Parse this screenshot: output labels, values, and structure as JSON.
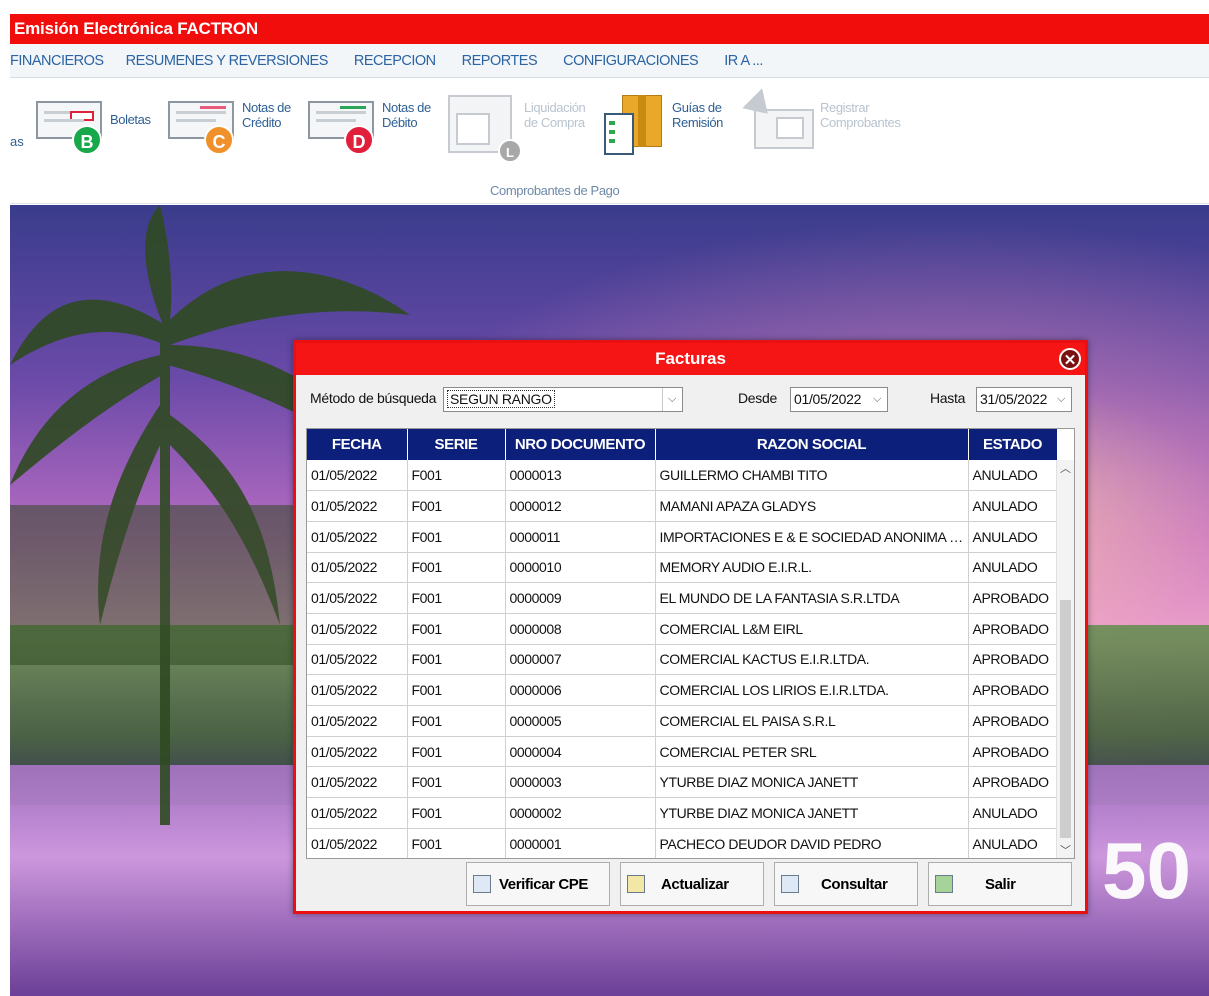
{
  "window": {
    "title": "Emisión Electrónica FACTRON"
  },
  "menu": [
    "FINANCIEROS",
    "RESUMENES Y REVERSIONES",
    "RECEPCION",
    "REPORTES",
    "CONFIGURACIONES",
    "IR A ..."
  ],
  "ribbon": {
    "partial_label": "as",
    "group_label": "Comprobantes de Pago",
    "buttons": {
      "boletas": {
        "label": "Boletas",
        "badge": "B",
        "badge_color": "#17a84b"
      },
      "notas_credito": {
        "line1": "Notas de",
        "line2": "Crédito",
        "badge": "C",
        "badge_color": "#f0902a"
      },
      "notas_debito": {
        "line1": "Notas de",
        "line2": "Débito",
        "badge": "D",
        "badge_color": "#e0203a"
      },
      "liquidacion": {
        "line1": "Liquidación",
        "line2": "de Compra",
        "badge": "L",
        "badge_color": "#a8a8a8"
      },
      "guias": {
        "line1": "Guías de",
        "line2": "Remisión"
      },
      "registrar": {
        "line1": "Registrar",
        "line2": "Comprobantes"
      }
    }
  },
  "dialog": {
    "title": "Facturas",
    "search_method_label": "Método de búsqueda",
    "search_method_value": "SEGUN RANGO",
    "from_label": "Desde",
    "from_value": "01/05/2022",
    "to_label": "Hasta",
    "to_value": "31/05/2022",
    "columns": [
      "FECHA",
      "SERIE",
      "NRO DOCUMENTO",
      "RAZON SOCIAL",
      "ESTADO"
    ],
    "rows": [
      [
        "01/05/2022",
        "F001",
        "0000013",
        "GUILLERMO CHAMBI TITO",
        "ANULADO"
      ],
      [
        "01/05/2022",
        "F001",
        "0000012",
        "MAMANI APAZA GLADYS",
        "ANULADO"
      ],
      [
        "01/05/2022",
        "F001",
        "0000011",
        "IMPORTACIONES E & E SOCIEDAD ANONIMA C...",
        "ANULADO"
      ],
      [
        "01/05/2022",
        "F001",
        "0000010",
        "MEMORY AUDIO E.I.R.L.",
        "ANULADO"
      ],
      [
        "01/05/2022",
        "F001",
        "0000009",
        "EL MUNDO DE LA FANTASIA S.R.LTDA",
        "APROBADO"
      ],
      [
        "01/05/2022",
        "F001",
        "0000008",
        "COMERCIAL L&M EIRL",
        "APROBADO"
      ],
      [
        "01/05/2022",
        "F001",
        "0000007",
        "COMERCIAL KACTUS E.I.R.LTDA.",
        "APROBADO"
      ],
      [
        "01/05/2022",
        "F001",
        "0000006",
        "COMERCIAL LOS LIRIOS E.I.R.LTDA.",
        "APROBADO"
      ],
      [
        "01/05/2022",
        "F001",
        "0000005",
        "COMERCIAL EL PAISA S.R.L",
        "APROBADO"
      ],
      [
        "01/05/2022",
        "F001",
        "0000004",
        "COMERCIAL PETER SRL",
        "APROBADO"
      ],
      [
        "01/05/2022",
        "F001",
        "0000003",
        "YTURBE DIAZ MONICA JANETT",
        "APROBADO"
      ],
      [
        "01/05/2022",
        "F001",
        "0000002",
        "YTURBE DIAZ MONICA JANETT",
        "ANULADO"
      ],
      [
        "01/05/2022",
        "F001",
        "0000001",
        "PACHECO DEUDOR DAVID PEDRO",
        "ANULADO"
      ]
    ],
    "buttons": {
      "verificar": "Verificar CPE",
      "actualizar": "Actualizar",
      "consultar": "Consultar",
      "salir": "Salir"
    }
  },
  "background_text": "50"
}
